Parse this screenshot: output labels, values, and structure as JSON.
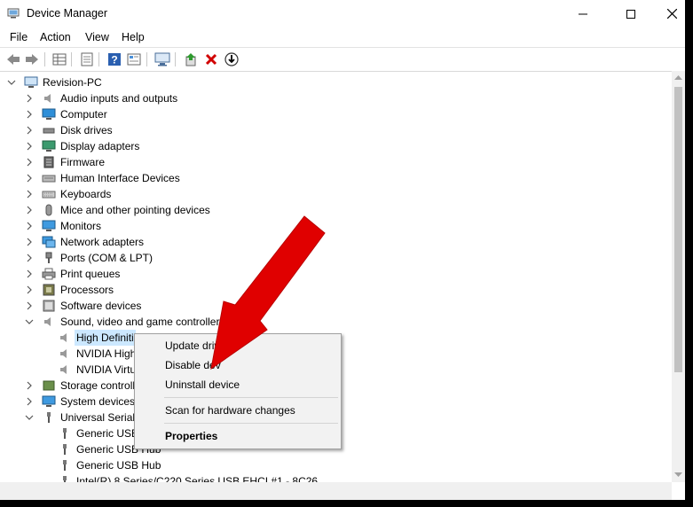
{
  "window": {
    "title": "Device Manager",
    "minimize_glyph": "—",
    "maximize_glyph": "☐",
    "close_glyph": "✕"
  },
  "menu": [
    "File",
    "Action",
    "View",
    "Help"
  ],
  "toolbar_icons": [
    "back-arrow-icon",
    "forward-arrow-icon",
    "properties-grid-icon",
    "update-list-icon",
    "help-icon",
    "view-resources-icon",
    "monitor-scan-icon",
    "enable-device-icon",
    "uninstall-x-icon",
    "download-driver-icon"
  ],
  "tree": {
    "root": "Revision-PC",
    "categories": [
      {
        "label": "Audio inputs and outputs",
        "icon": "speaker-icon"
      },
      {
        "label": "Computer",
        "icon": "computer-icon"
      },
      {
        "label": "Disk drives",
        "icon": "disk-drive-icon"
      },
      {
        "label": "Display adapters",
        "icon": "display-adapter-icon"
      },
      {
        "label": "Firmware",
        "icon": "firmware-chip-icon"
      },
      {
        "label": "Human Interface Devices",
        "icon": "hid-icon"
      },
      {
        "label": "Keyboards",
        "icon": "keyboard-icon"
      },
      {
        "label": "Mice and other pointing devices",
        "icon": "mouse-icon"
      },
      {
        "label": "Monitors",
        "icon": "monitor-icon"
      },
      {
        "label": "Network adapters",
        "icon": "network-adapter-icon"
      },
      {
        "label": "Ports (COM & LPT)",
        "icon": "port-icon"
      },
      {
        "label": "Print queues",
        "icon": "printer-icon"
      },
      {
        "label": "Processors",
        "icon": "processor-icon"
      },
      {
        "label": "Software devices",
        "icon": "software-device-icon"
      },
      {
        "label": "Sound, video and game controllers",
        "icon": "speaker-icon"
      }
    ],
    "sound_children": [
      "High Definiti",
      "NVIDIA High",
      "NVIDIA Virtu"
    ],
    "after_categories": [
      {
        "label": "Storage controlle",
        "icon": "storage-controller-icon"
      },
      {
        "label": "System devices",
        "icon": "system-device-icon"
      },
      {
        "label": "Universal Serial E",
        "icon": "usb-icon"
      }
    ],
    "usb_children": [
      "Generic USB",
      "Generic USB Hub",
      "Generic USB Hub",
      "Intel(R) 8 Series/C220 Series USB EHCI #1 - 8C26"
    ]
  },
  "context_menu": {
    "update": "Update driv",
    "disable": "Disable dev",
    "uninstall": "Uninstall device",
    "scan": "Scan for hardware changes",
    "properties": "Properties"
  },
  "colors": {
    "selection": "#cce8ff",
    "arrow": "#e00000",
    "uninstall_x": "#d10000",
    "help_blue": "#2a5fb0"
  }
}
